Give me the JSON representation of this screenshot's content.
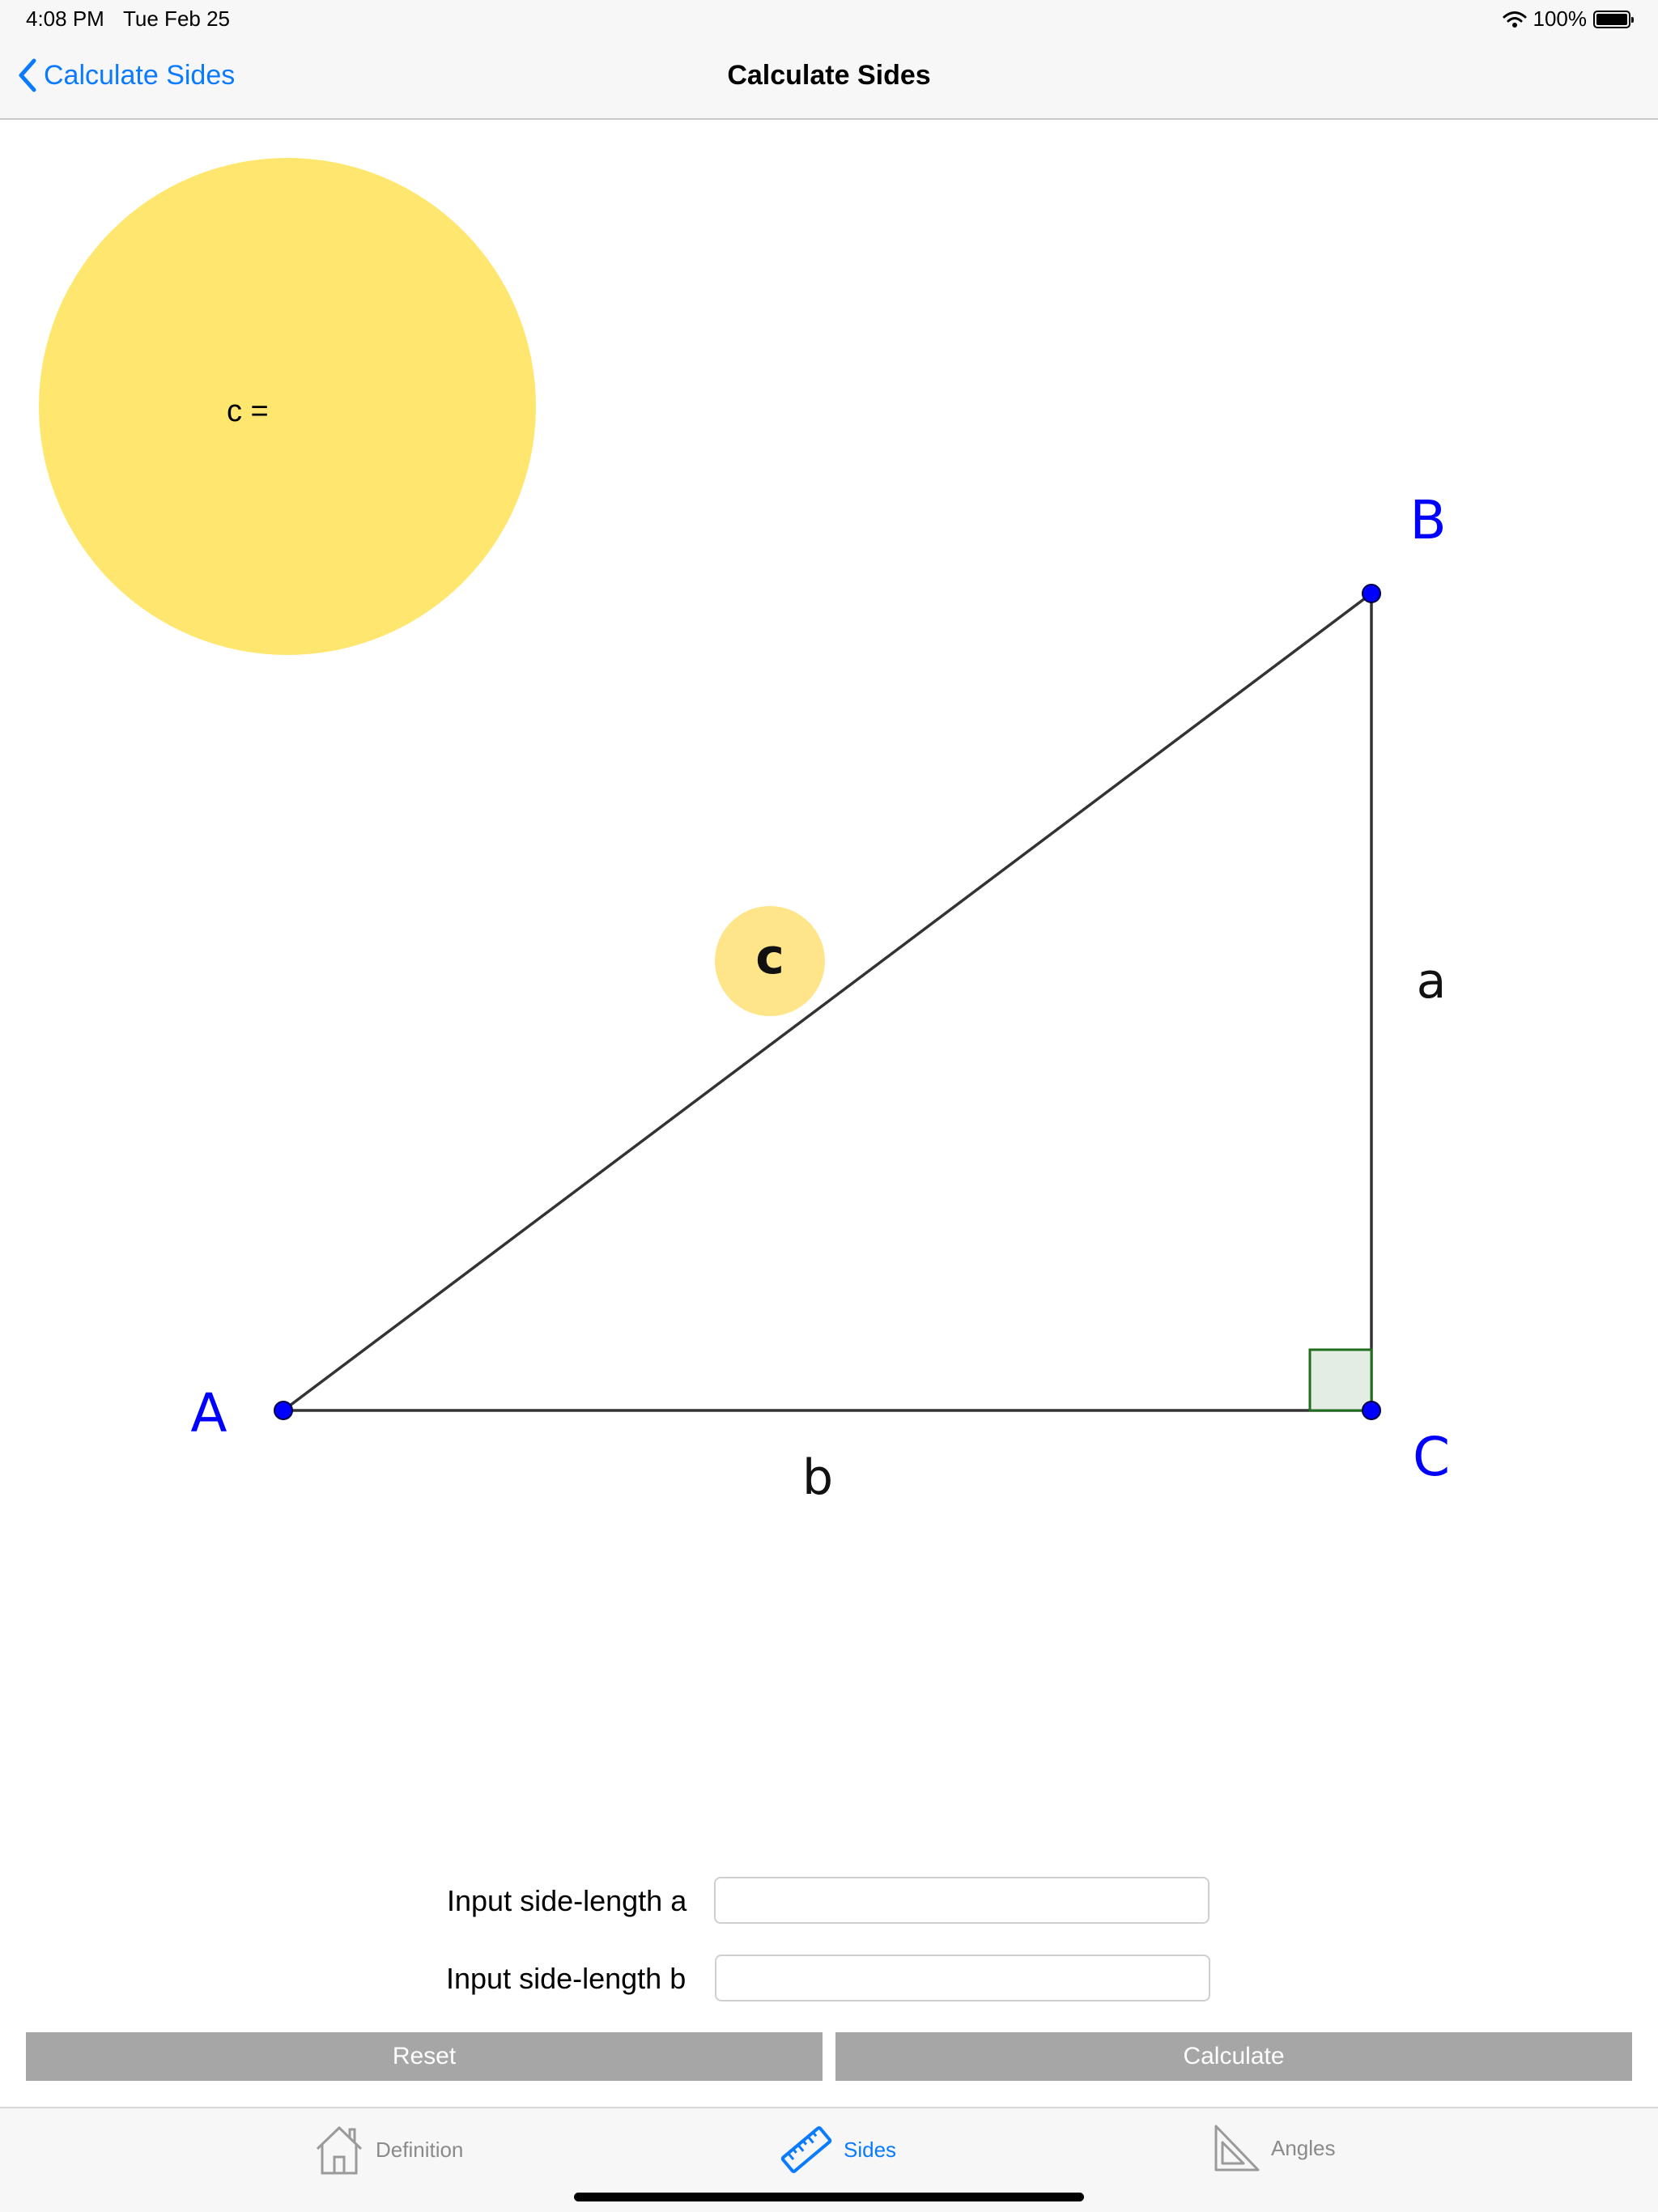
{
  "status_bar": {
    "time": "4:08 PM",
    "date": "Tue Feb 25",
    "battery_percent": "100%"
  },
  "nav": {
    "back_label": "Calculate Sides",
    "title": "Calculate Sides"
  },
  "diagram": {
    "result_text": "c =",
    "point_labels": {
      "a": "A",
      "b": "B",
      "c": "C"
    },
    "side_labels": {
      "a": "a",
      "b": "b",
      "c": "c"
    },
    "colors": {
      "result_circle": "#ffe76f",
      "hypotenuse_badge": "#ffe58a",
      "points": "#0000ff",
      "right_angle_fill": "#e3ede3",
      "right_angle_stroke": "#1e6e1e",
      "lines": "#333333"
    }
  },
  "form": {
    "label_a": "Input side-length a",
    "label_b": "Input side-length b",
    "value_a": "",
    "value_b": "",
    "reset_label": "Reset",
    "calculate_label": "Calculate"
  },
  "tab_bar": {
    "tabs": [
      {
        "label": "Definition",
        "icon": "house-icon",
        "active": false
      },
      {
        "label": "Sides",
        "icon": "ruler-icon",
        "active": true
      },
      {
        "label": "Angles",
        "icon": "set-square-icon",
        "active": false
      }
    ],
    "active_color": "#0a7aff",
    "inactive_color": "#8a8a8a"
  }
}
